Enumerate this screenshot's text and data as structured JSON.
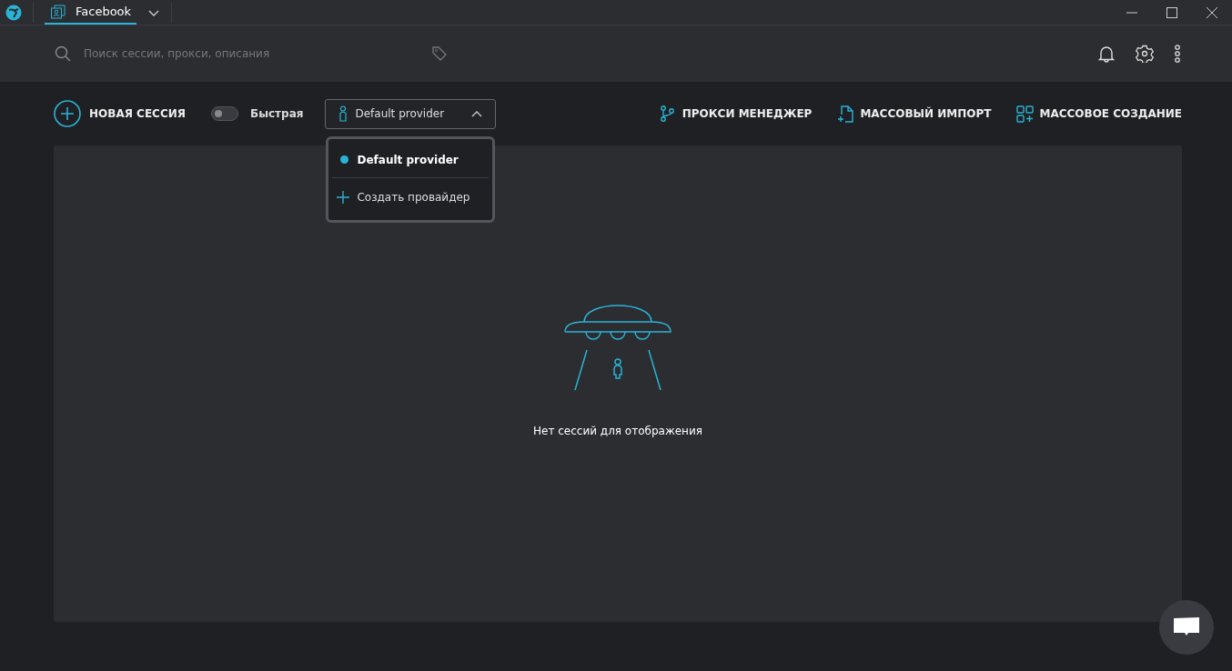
{
  "window": {
    "tabs": [
      {
        "label": "Facebook",
        "selected": true
      }
    ]
  },
  "search": {
    "placeholder": "Поиск сессии, прокси, описания"
  },
  "toolbar": {
    "new_session": "НОВАЯ СЕССИЯ",
    "quick": {
      "label": "Быстрая",
      "on": false
    },
    "provider": {
      "value": "Default provider",
      "expanded": true
    },
    "actions": [
      {
        "kind": "proxy",
        "label": "ПРОКСИ МЕНЕДЖЕР"
      },
      {
        "kind": "import",
        "label": "МАССОВЫЙ ИМПОРТ"
      },
      {
        "kind": "create",
        "label": "МАССОВОЕ СОЗДАНИЕ"
      }
    ]
  },
  "provider_menu": {
    "items": [
      {
        "label": "Default provider",
        "selected": true
      }
    ],
    "create": "Создать провайдер"
  },
  "empty_state": {
    "message": "Нет сессий для отображения"
  }
}
